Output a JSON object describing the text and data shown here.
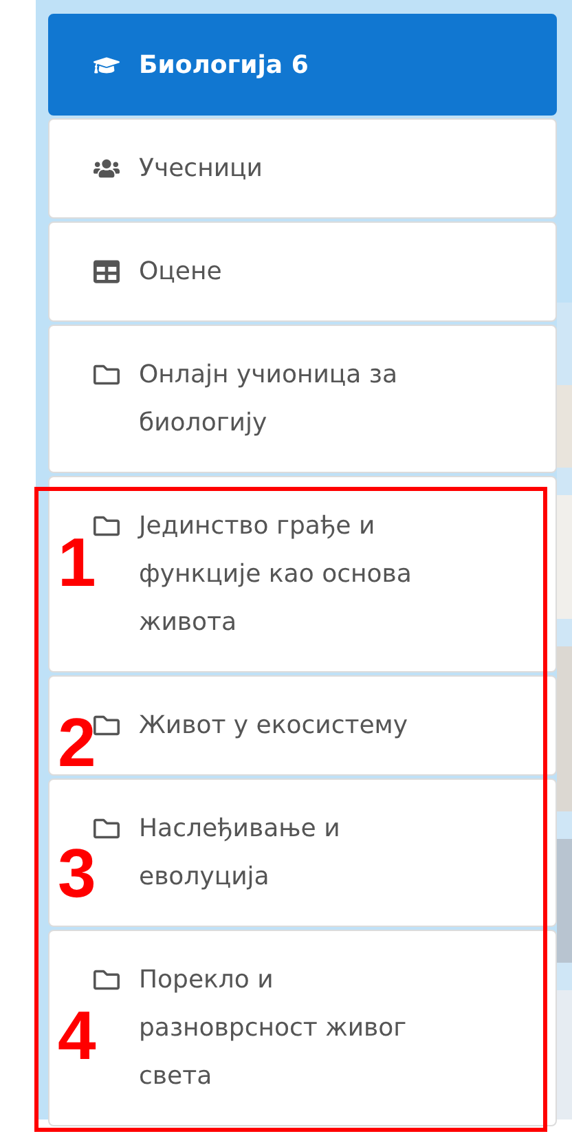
{
  "navigation": {
    "items": [
      {
        "kind": "course",
        "label": "Биологија 6",
        "selected": true
      },
      {
        "kind": "participants",
        "label": "Учесници",
        "selected": false
      },
      {
        "kind": "grades",
        "label": "Оцене",
        "selected": false
      },
      {
        "kind": "folder",
        "label": "Онлајн учионица за биологију",
        "selected": false
      },
      {
        "kind": "folder",
        "label": "Јединство грађе и функције као основа живота",
        "selected": false,
        "marker": "1"
      },
      {
        "kind": "folder",
        "label": "Живот у екосистему",
        "selected": false,
        "marker": "2"
      },
      {
        "kind": "folder",
        "label": "Наслеђивање и еволуција",
        "selected": false,
        "marker": "3"
      },
      {
        "kind": "folder",
        "label": "Порекло и разноврсност живог света",
        "selected": false,
        "marker": "4"
      }
    ]
  }
}
